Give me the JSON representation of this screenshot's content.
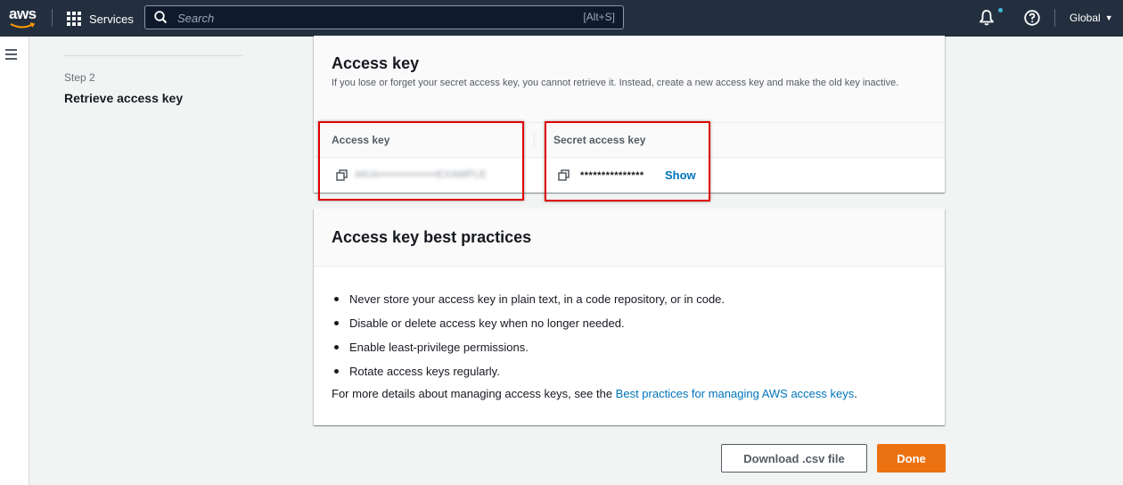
{
  "nav": {
    "logo_text": "aws",
    "services_label": "Services",
    "search_placeholder": "Search",
    "search_shortcut": "[Alt+S]",
    "region_label": "Global",
    "notification_dot_color": "#44b9d6"
  },
  "steps": {
    "current_step_label": "Step 2",
    "current_step_title": "Retrieve access key"
  },
  "access_key_card": {
    "title": "Access key",
    "description": "If you lose or forget your secret access key, you cannot retrieve it. Instead, create a new access key and make the old key inactive.",
    "access_key_header": "Access key",
    "access_key_value": "AKIA•••••••••••••••EXAMPLE",
    "secret_key_header": "Secret access key",
    "secret_key_masked": "***************",
    "show_label": "Show"
  },
  "best_practices_card": {
    "title": "Access key best practices",
    "items": [
      "Never store your access key in plain text, in a code repository, or in code.",
      "Disable or delete access key when no longer needed.",
      "Enable least-privilege permissions.",
      "Rotate access keys regularly."
    ],
    "more_prefix": "For more details about managing access keys, see the ",
    "more_link": "Best practices for managing AWS access keys",
    "more_suffix": "."
  },
  "actions": {
    "download_label": "Download .csv file",
    "done_label": "Done"
  },
  "colors": {
    "nav_bg": "#232f3e",
    "primary_button": "#ec7211",
    "link": "#0073bb",
    "highlight_box": "#e00000"
  }
}
